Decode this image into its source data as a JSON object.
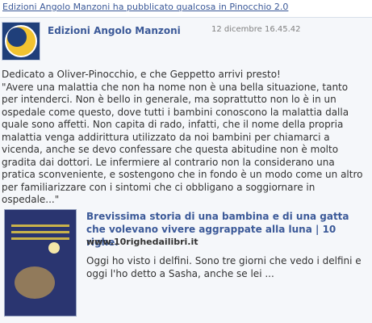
{
  "header": {
    "link_text": "Edizioni Angolo Manzoni ha pubblicato qualcosa in Pinocchio 2.0"
  },
  "post": {
    "author": "Edizioni Angolo Manzoni",
    "timestamp": "12 dicembre 16.45.42",
    "avatar_icon": "grandi-caratteri-logo",
    "message_line1": "Dedicato a Oliver-Pinocchio, e che Geppetto arrivi presto!",
    "message_body": "\"Avere una malattia che non ha nome non è una bella situazione, tanto per intenderci. Non è bello in generale, ma soprattutto non lo è in un ospedale come questo, dove tutti i bambini conoscono la malattia dalla quale sono affetti. Non capita di rado, infatti, che il nome della propria malattia venga addirittura utilizzato da noi bambini per chiamarci a vicenda, anche se devo confessare che questa abitudine non è molto gradita dai dottori. Le infermiere al contrario non la considerano una pratica sconveniente, e sostengono che in fondo è un modo come un altro per familiarizzare con i sintomi che ci obbligano a soggiornare in ospedale...\""
  },
  "attachment": {
    "title": "Brevissima storia di una bambina e di una gatta che volevano vivere aggrappate alla luna | 10 righe.",
    "source": "www.10righedailibri.it",
    "description": "Oggi ho visto i delfini. Sono tre giorni che vedo i delfini e oggi l'ho detto a Sasha, anche se lei ..."
  }
}
